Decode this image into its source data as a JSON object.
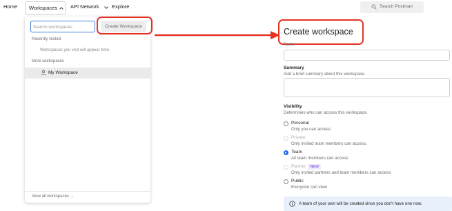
{
  "header": {
    "nav": [
      {
        "label": "Home"
      },
      {
        "label": "Workspaces"
      },
      {
        "label": "API Network"
      },
      {
        "label": "Explore"
      }
    ],
    "search": {
      "placeholder": "Search Postman",
      "icon": "search-icon"
    }
  },
  "dropdown": {
    "search_placeholder": "Search workspaces",
    "create_label": "Create Workspace",
    "recent_heading": "Recently visited",
    "recent_empty": "Workspaces you visit will appear here.",
    "more_heading": "More workspaces",
    "items": [
      {
        "label": "My Workspace",
        "icon": "user-icon"
      }
    ],
    "footer": "View all workspaces →"
  },
  "form": {
    "title": "Create workspace",
    "name_label": "Name",
    "summary_label": "Summary",
    "summary_help": "Add a brief summary about this workspace.",
    "visibility_label": "Visibility",
    "visibility_help": "Determines who can access this workspace.",
    "options": [
      {
        "title": "Personal",
        "desc": "Only you can access",
        "selected": false,
        "disabled": false,
        "badge": ""
      },
      {
        "title": "Private",
        "desc": "Only invited team members can access.",
        "selected": false,
        "disabled": true,
        "badge": ""
      },
      {
        "title": "Team",
        "desc": "All team members can access",
        "selected": true,
        "disabled": false,
        "badge": ""
      },
      {
        "title": "Partner",
        "desc": "Only invited partners and team members can access",
        "selected": false,
        "disabled": true,
        "badge": "NEW"
      },
      {
        "title": "Public",
        "desc": "Everyone can view",
        "selected": false,
        "disabled": false,
        "badge": ""
      }
    ],
    "info": "A team of your own will be created since you don't have one now.",
    "info_icon": "info-icon"
  },
  "colors": {
    "highlight": "#e53223",
    "accent": "#1a66e8",
    "info_bg": "#e8f0fb"
  }
}
